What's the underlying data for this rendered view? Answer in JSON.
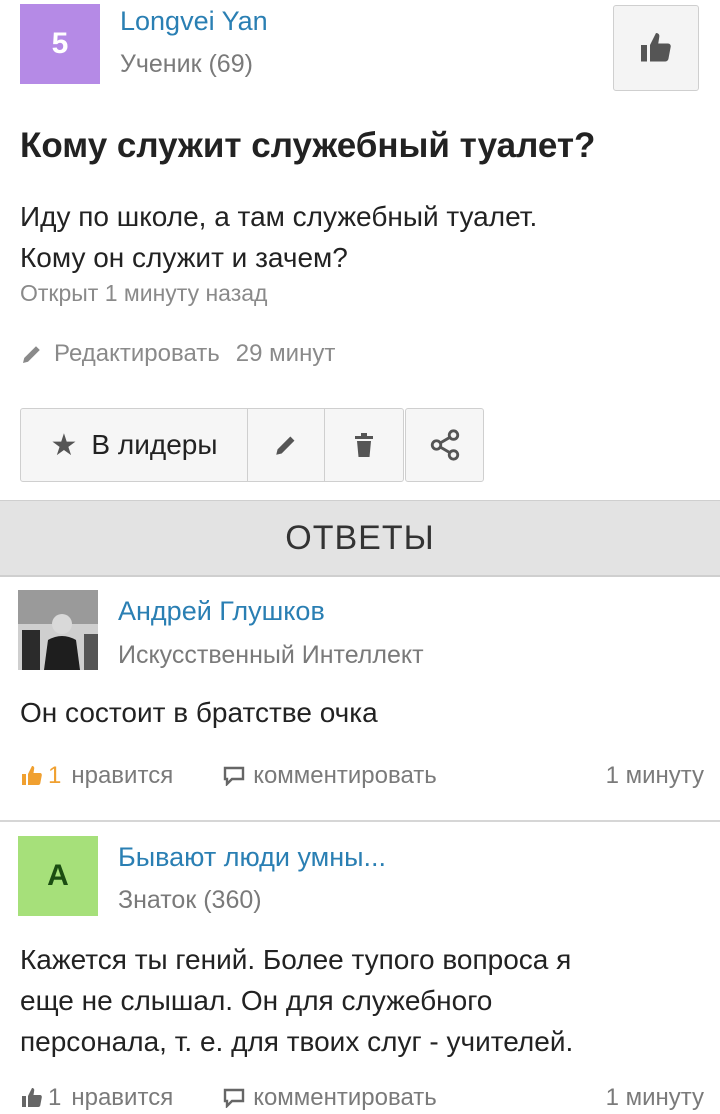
{
  "question": {
    "author": {
      "avatar_letter": "5",
      "name": "Longvei Yan",
      "rank": "Ученик (69)"
    },
    "title": "Кому служит служебный туалет?",
    "body_line1": "Иду по школе, а там служебный туалет.",
    "body_line2": "Кому он служит и зачем?",
    "opened": "Открыт 1 минуту назад",
    "edit_label": "Редактировать",
    "edit_time": "29 минут"
  },
  "actions": {
    "leaders_label": "В лидеры"
  },
  "answers_header": "ОТВЕТЫ",
  "answers": [
    {
      "name": "Андрей Глушков",
      "rank": "Искусственный Интеллект",
      "text_line1": "Он состоит в братстве очка",
      "likes_count": "1",
      "likes_label": "нравится",
      "comment_label": "комментировать",
      "time": "1 минуту"
    },
    {
      "avatar_letter": "А",
      "name": "Бывают люди умны...",
      "rank": "Знаток (360)",
      "text_line1": "Кажется ты гений. Более тупого вопроса я",
      "text_line2": "еще не слышал. Он для служебного",
      "text_line3": "персонала, т. е. для твоих слуг - учителей.",
      "likes_count": "1",
      "likes_label": "нравится",
      "comment_label": "комментировать",
      "time": "1 минуту"
    }
  ],
  "colors": {
    "link": "#2a7fb3",
    "avatar_purple": "#b58ae6",
    "avatar_green": "#a6e07a",
    "like_orange": "#f0a030"
  },
  "icons": [
    "thumbs-up-icon",
    "pencil-icon",
    "star-icon",
    "trash-icon",
    "share-icon",
    "comment-icon"
  ]
}
